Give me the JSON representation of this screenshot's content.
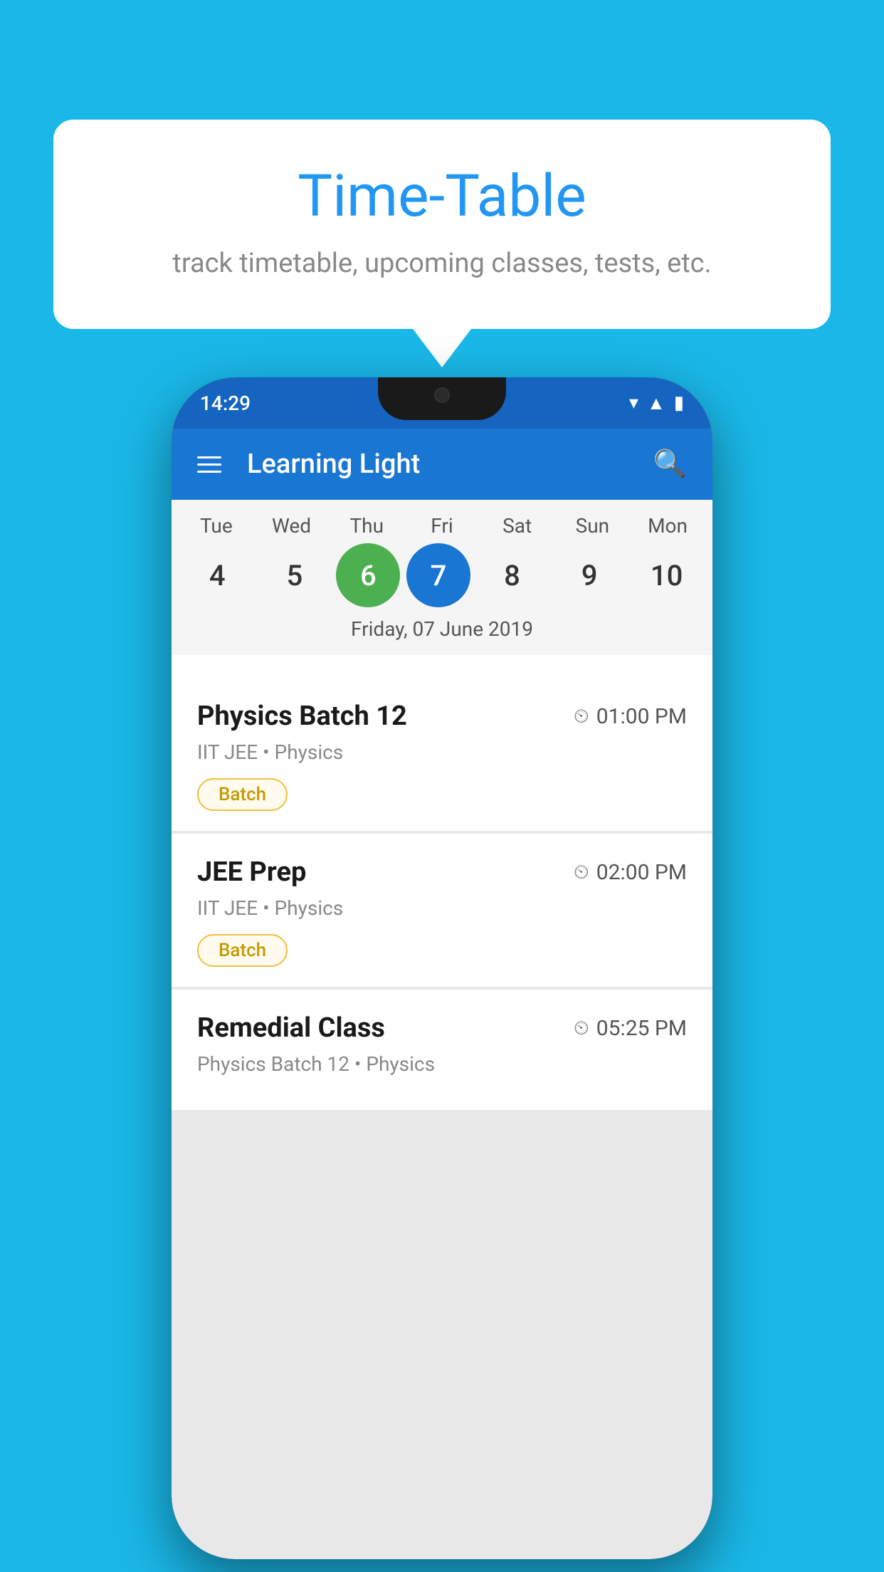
{
  "background_color": "#1ab8e8",
  "speech_bubble": {
    "title": "Time-Table",
    "subtitle": "track timetable, upcoming classes, tests, etc."
  },
  "phone": {
    "status_bar": {
      "time": "14:29",
      "icons": [
        "wifi",
        "signal",
        "battery"
      ]
    },
    "app_bar": {
      "title": "Learning Light"
    },
    "calendar": {
      "days": [
        {
          "label": "Tue",
          "num": "4"
        },
        {
          "label": "Wed",
          "num": "5"
        },
        {
          "label": "Thu",
          "num": "6",
          "state": "today"
        },
        {
          "label": "Fri",
          "num": "7",
          "state": "selected"
        },
        {
          "label": "Sat",
          "num": "8"
        },
        {
          "label": "Sun",
          "num": "9"
        },
        {
          "label": "Mon",
          "num": "10"
        }
      ],
      "selected_date": "Friday, 07 June 2019"
    },
    "schedule": [
      {
        "title": "Physics Batch 12",
        "time": "01:00 PM",
        "subtitle": "IIT JEE • Physics",
        "badge": "Batch"
      },
      {
        "title": "JEE Prep",
        "time": "02:00 PM",
        "subtitle": "IIT JEE • Physics",
        "badge": "Batch"
      },
      {
        "title": "Remedial Class",
        "time": "05:25 PM",
        "subtitle": "Physics Batch 12 • Physics",
        "badge": null
      }
    ]
  }
}
